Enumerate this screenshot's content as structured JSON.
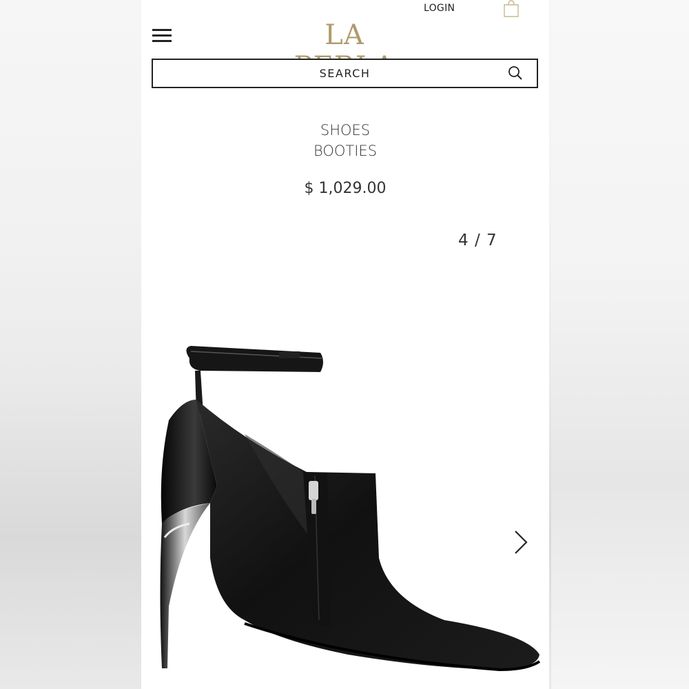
{
  "header": {
    "login_label": "LOGIN",
    "logo_text": "LA PERLA",
    "menu_icon": "hamburger-menu-icon",
    "bag_icon": "shopping-bag-icon"
  },
  "search": {
    "placeholder": "SEARCH",
    "icon": "search-icon"
  },
  "product": {
    "category": "SHOES",
    "subcategory": "BOOTIES",
    "price": "$ 1,029.00"
  },
  "gallery": {
    "pager": "4 / 7",
    "next_icon": "chevron-right-icon"
  },
  "colors": {
    "brand_gold": "#b09a6b",
    "text": "#333333",
    "border": "#222222"
  }
}
